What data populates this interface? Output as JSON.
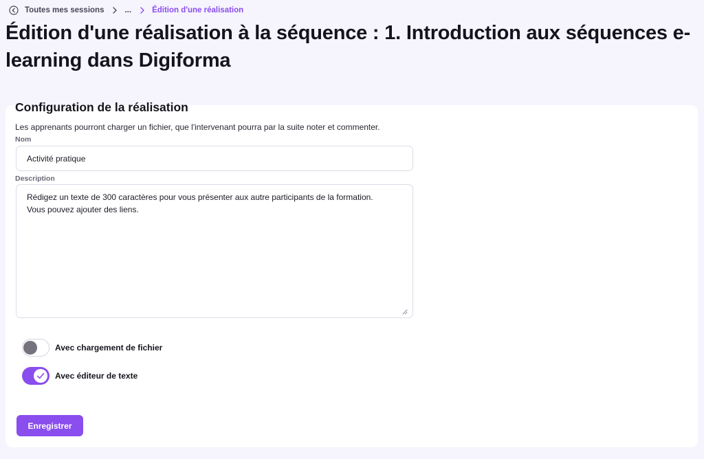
{
  "breadcrumb": {
    "items": [
      {
        "label": "Toutes mes sessions"
      },
      {
        "label": "..."
      },
      {
        "label": "Édition d'une réalisation"
      }
    ]
  },
  "page": {
    "title": "Édition d'une réalisation à la séquence : 1. Introduction aux séquences e-learning dans Digiforma"
  },
  "config": {
    "title": "Configuration de la réalisation",
    "description": "Les apprenants pourront charger un fichier, que l'intervenant pourra par la suite noter et commenter.",
    "name_label": "Nom",
    "name_value": "Activité pratique",
    "description_label": "Description",
    "description_value": "Rédigez un texte de 300 caractères pour vous présenter aux autre participants de la formation.\nVous pouvez ajouter des liens.",
    "toggles": [
      {
        "label": "Avec chargement de fichier",
        "checked": false
      },
      {
        "label": "Avec éditeur de texte",
        "checked": true
      }
    ],
    "save_label": "Enregistrer"
  },
  "colors": {
    "accent": "#8a4dee",
    "background": "#f6f4fd",
    "card": "#ffffff",
    "toggle_off_knob": "#76737d"
  },
  "icons": {
    "back": "chevron-left-circle-icon",
    "separator": "chevron-right-icon",
    "check": "check-icon",
    "resize": "resize-handle-icon"
  }
}
